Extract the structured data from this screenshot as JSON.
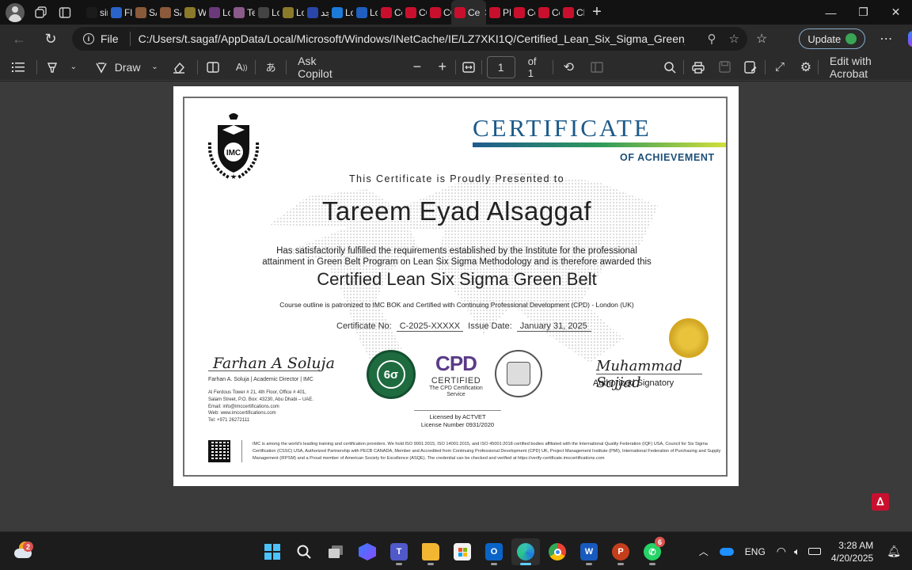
{
  "tabs": [
    {
      "label": "sir",
      "fav_color": "#1b1b1b"
    },
    {
      "label": "Fly",
      "fav_color": "#2a64c8"
    },
    {
      "label": "SA",
      "fav_color": "#8a5a3a"
    },
    {
      "label": "SA",
      "fav_color": "#8a5a3a"
    },
    {
      "label": "W",
      "fav_color": "#8a7a2a"
    },
    {
      "label": "Lo",
      "fav_color": "#6a3a7a"
    },
    {
      "label": "Te",
      "fav_color": "#8a5a8a"
    },
    {
      "label": "Lo",
      "fav_color": "#444444"
    },
    {
      "label": "Lo",
      "fav_color": "#8a7a2a"
    },
    {
      "label": "جد",
      "fav_color": "#2a46a8"
    },
    {
      "label": "Lo",
      "fav_color": "#1c7ad8"
    },
    {
      "label": "Lo",
      "fav_color": "#1e5fbf"
    },
    {
      "label": "Ce",
      "fav_color": "#c8102e"
    },
    {
      "label": "CC",
      "fav_color": "#c8102e"
    },
    {
      "label": "CC",
      "fav_color": "#c8102e"
    },
    {
      "label": "Ce",
      "fav_color": "#c8102e"
    },
    {
      "label": "PN",
      "fav_color": "#c8102e"
    },
    {
      "label": "Ce",
      "fav_color": "#c8102e"
    },
    {
      "label": "Ce",
      "fav_color": "#c8102e"
    },
    {
      "label": "CE",
      "fav_color": "#c8102e"
    }
  ],
  "active_tab_index": 15,
  "address": {
    "scheme_label": "File",
    "url": "C:/Users/t.sagaf/AppData/Local/Microsoft/Windows/INetCache/IE/LZ7XKI1Q/Certified_Lean_Six_Sigma_Green_Belt_-_Taree...",
    "update_label": "Update"
  },
  "pdf_toolbar": {
    "draw_label": "Draw",
    "ask_copilot_label": "Ask Copilot",
    "page_number": "1",
    "page_total": "of 1",
    "edit_acrobat_label": "Edit with Acrobat"
  },
  "certificate": {
    "org_logo_text": "IMC",
    "title": "CERTIFICATE",
    "subtitle": "OF ACHIEVEMENT",
    "presented_line": "This Certificate is Proudly Presented to",
    "recipient": "Tareem Eyad Alsaggaf",
    "body": "Has satisfactorily fulfilled the requirements established by the Institute for the professional attainment in Green Belt Program on Lean Six Sigma Methodology and is therefore awarded this",
    "program": "Certified Lean Six Sigma Green Belt",
    "course_line": "Course outline is patronized to IMC BOK and Certified with Continuing Professional Development (CPD) - London (UK)",
    "cert_no_label": "Certificate No:",
    "cert_no_value": "C-2025-XXXXX",
    "issue_date_label": "Issue Date:",
    "issue_date_value": "January 31, 2025",
    "left_signature": "Farhan A Soluja",
    "left_signer": "Farhan A. Soluja | Academic Director | IMC",
    "address_lines": [
      "Al Ferdous Tower # 21, 4th Floor, Office # 401,",
      "Salam Street, P.O. Box: 43230, Abu Dhabi – UAE.",
      "Email: info@imccertifications.com",
      "Web: www.imccertifications.com",
      "Tel: +971 26272111"
    ],
    "cpd_big": "CPD",
    "cpd_certified": "CERTIFIED",
    "cpd_service": "The CPD Certification Service",
    "right_signature": "Muhammad Sajjad",
    "right_signer": "Authorized Signatory",
    "license_line1": "Licensed by ACTVET",
    "license_line2": "License Number 0931/2020",
    "footer": "IMC is among the world's leading training and certification providers. We hold ISO 9001:2015, ISO 14001:2015, and ISO 45001:2018 certified bodies affiliated with the International Quality Federation (IQF) USA, Council for Six Sigma Certification (CSSC) USA, Authorized Partnership with PECB CANADA, Member and Accredited from Continuing Professional Development (CPD) UK, Project Management Institute (PMI), International Federation of Purchasing and Supply Management (IFPSM) and a Proud member of American Society for Excellence (ASQE). The credential can be checked and verified at https://verify-certificate.imccertifications.com"
  },
  "taskbar": {
    "weather_badge": "2",
    "whatsapp_badge": "6",
    "language": "ENG",
    "time": "3:28 AM",
    "date": "4/20/2025"
  }
}
